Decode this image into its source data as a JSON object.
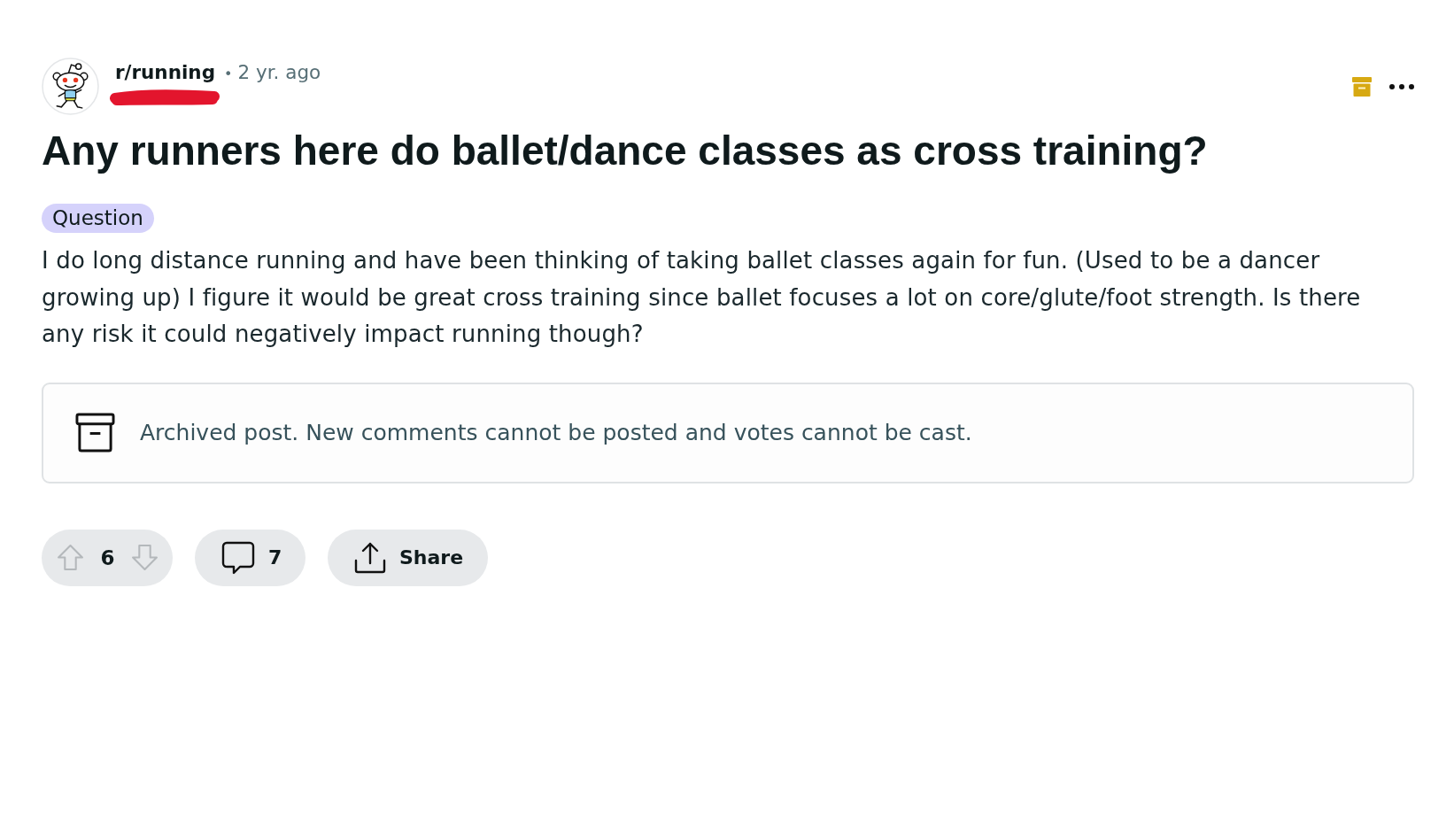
{
  "post": {
    "subreddit": "r/running",
    "separator": "•",
    "age": "2 yr. ago",
    "archived": true,
    "title": "Any runners here do ballet/dance classes as cross training?",
    "flair": "Question",
    "body": "I do long distance running and have been thinking of taking ballet classes again for fun. (Used to be a dancer growing up) I figure it would be great cross training since ballet focuses a lot on core/glute/foot strength. Is there any risk it could negatively impact running though?"
  },
  "archived_notice": "Archived post. New comments cannot be posted and votes cannot be cast.",
  "actions": {
    "votes": {
      "count": "6",
      "disabled": true
    },
    "comments": {
      "count": "7"
    },
    "share": {
      "label": "Share"
    }
  }
}
